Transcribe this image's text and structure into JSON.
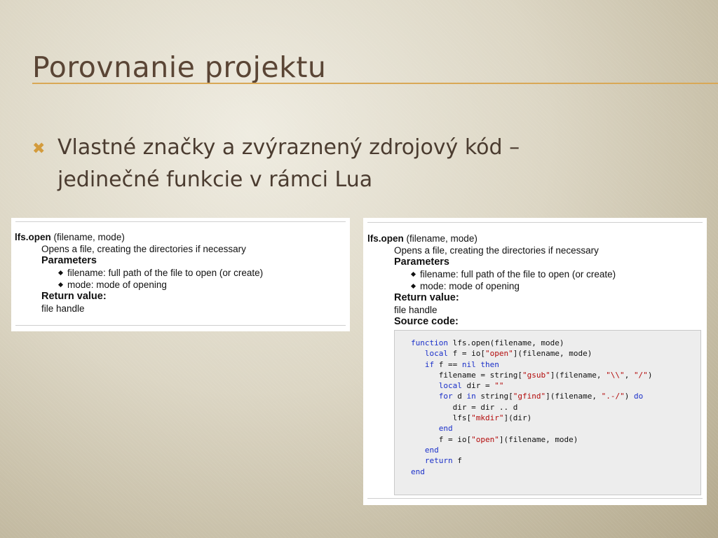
{
  "slide": {
    "title": "Porovnanie projektu",
    "bullet": "Vlastné značky a zvýraznený zdrojový kód – jedinečné funkcie v rámci Lua"
  },
  "doc_left": {
    "function_name": "lfs.open",
    "signature": "(filename, mode)",
    "description": "Opens a file, creating the directories if necessary",
    "parameters_heading": "Parameters",
    "parameters": [
      "filename: full path of the file to open (or create)",
      "mode: mode of opening"
    ],
    "return_heading": "Return value:",
    "return_value": "file handle"
  },
  "doc_right": {
    "function_name": "lfs.open",
    "signature": "(filename, mode)",
    "description": "Opens a file, creating the directories if necessary",
    "parameters_heading": "Parameters",
    "parameters": [
      "filename: full path of the file to open (or create)",
      "mode: mode of opening"
    ],
    "return_heading": "Return value:",
    "return_value": "file handle",
    "source_heading": "Source code:",
    "code_lines": [
      [
        {
          "t": "function",
          "c": "kw"
        },
        {
          "t": " lfs.open(filename, mode)",
          "c": ""
        }
      ],
      [
        {
          "t": "   ",
          "c": ""
        },
        {
          "t": "local",
          "c": "kw"
        },
        {
          "t": " f = io[",
          "c": ""
        },
        {
          "t": "\"open\"",
          "c": "str"
        },
        {
          "t": "](filename, mode)",
          "c": ""
        }
      ],
      [
        {
          "t": "   ",
          "c": ""
        },
        {
          "t": "if",
          "c": "kw"
        },
        {
          "t": " f == ",
          "c": ""
        },
        {
          "t": "nil",
          "c": "kw"
        },
        {
          "t": " ",
          "c": ""
        },
        {
          "t": "then",
          "c": "kw"
        }
      ],
      [
        {
          "t": "      filename = string[",
          "c": ""
        },
        {
          "t": "\"gsub\"",
          "c": "str"
        },
        {
          "t": "](filename, ",
          "c": ""
        },
        {
          "t": "\"\\\\\"",
          "c": "str"
        },
        {
          "t": ", ",
          "c": ""
        },
        {
          "t": "\"/\"",
          "c": "str"
        },
        {
          "t": ")",
          "c": ""
        }
      ],
      [
        {
          "t": "      ",
          "c": ""
        },
        {
          "t": "local",
          "c": "kw"
        },
        {
          "t": " dir = ",
          "c": ""
        },
        {
          "t": "\"\"",
          "c": "str"
        }
      ],
      [
        {
          "t": "      ",
          "c": ""
        },
        {
          "t": "for",
          "c": "kw"
        },
        {
          "t": " d ",
          "c": ""
        },
        {
          "t": "in",
          "c": "kw"
        },
        {
          "t": " string[",
          "c": ""
        },
        {
          "t": "\"gfind\"",
          "c": "str"
        },
        {
          "t": "](filename, ",
          "c": ""
        },
        {
          "t": "\".-/\"",
          "c": "str"
        },
        {
          "t": ") ",
          "c": ""
        },
        {
          "t": "do",
          "c": "kw"
        }
      ],
      [
        {
          "t": "         dir = dir .. d",
          "c": ""
        }
      ],
      [
        {
          "t": "         lfs[",
          "c": ""
        },
        {
          "t": "\"mkdir\"",
          "c": "str"
        },
        {
          "t": "](dir)",
          "c": ""
        }
      ],
      [
        {
          "t": "      ",
          "c": ""
        },
        {
          "t": "end",
          "c": "kw"
        }
      ],
      [
        {
          "t": "      f = io[",
          "c": ""
        },
        {
          "t": "\"open\"",
          "c": "str"
        },
        {
          "t": "](filename, mode)",
          "c": ""
        }
      ],
      [
        {
          "t": "   ",
          "c": ""
        },
        {
          "t": "end",
          "c": "kw"
        }
      ],
      [
        {
          "t": "   ",
          "c": ""
        },
        {
          "t": "return",
          "c": "kw"
        },
        {
          "t": " f",
          "c": ""
        }
      ],
      [
        {
          "t": "end",
          "c": "kw"
        }
      ]
    ]
  },
  "colors": {
    "title": "#5a4535",
    "accent": "#d39b3c",
    "keyword": "#1a2fc9",
    "string": "#b30b0b"
  },
  "icons": {
    "bullet": "x-mark-icon"
  }
}
